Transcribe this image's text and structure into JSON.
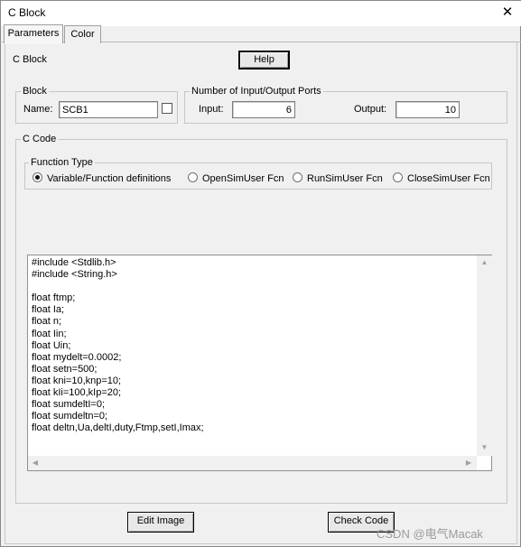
{
  "window": {
    "title": "C Block",
    "close_symbol": "✕"
  },
  "tabs": [
    {
      "label": "Parameters",
      "active": true
    },
    {
      "label": "Color",
      "active": false
    }
  ],
  "header": {
    "block_type_label": "C Block",
    "help_label": "Help"
  },
  "block": {
    "legend": "Block",
    "name_label": "Name:",
    "name_value": "SCB1",
    "checkbox_checked": false
  },
  "ports": {
    "legend": "Number of Input/Output Ports",
    "input_label": "Input:",
    "input_value": "6",
    "output_label": "Output:",
    "output_value": "10"
  },
  "ccode": {
    "legend": "C Code",
    "function_type": {
      "legend": "Function Type",
      "options": [
        {
          "label": "Variable/Function definitions",
          "selected": true
        },
        {
          "label": "OpenSimUser Fcn",
          "selected": false
        },
        {
          "label": "RunSimUser Fcn",
          "selected": false
        },
        {
          "label": "CloseSimUser Fcn",
          "selected": false
        }
      ]
    },
    "code": "#include <Stdlib.h>\n#include <String.h>\n\nfloat ftmp;\nfloat Ia;\nfloat n;\nfloat Iin;\nfloat Uin;\nfloat mydelt=0.0002;\nfloat setn=500;\nfloat kni=10,knp=10;\nfloat kIi=100,kIp=20;\nfloat sumdeltI=0;\nfloat sumdeltn=0;\nfloat deltn,Ua,deltI,duty,Ftmp,setI,Imax;"
  },
  "footer": {
    "edit_image_label": "Edit Image",
    "check_code_label": "Check Code"
  },
  "watermark": "CSDN @电气Macak",
  "icons": {
    "close": "close-icon",
    "scroll_up": "scroll-up-icon",
    "scroll_down": "scroll-down-icon",
    "scroll_left": "scroll-left-icon",
    "scroll_right": "scroll-right-icon"
  }
}
